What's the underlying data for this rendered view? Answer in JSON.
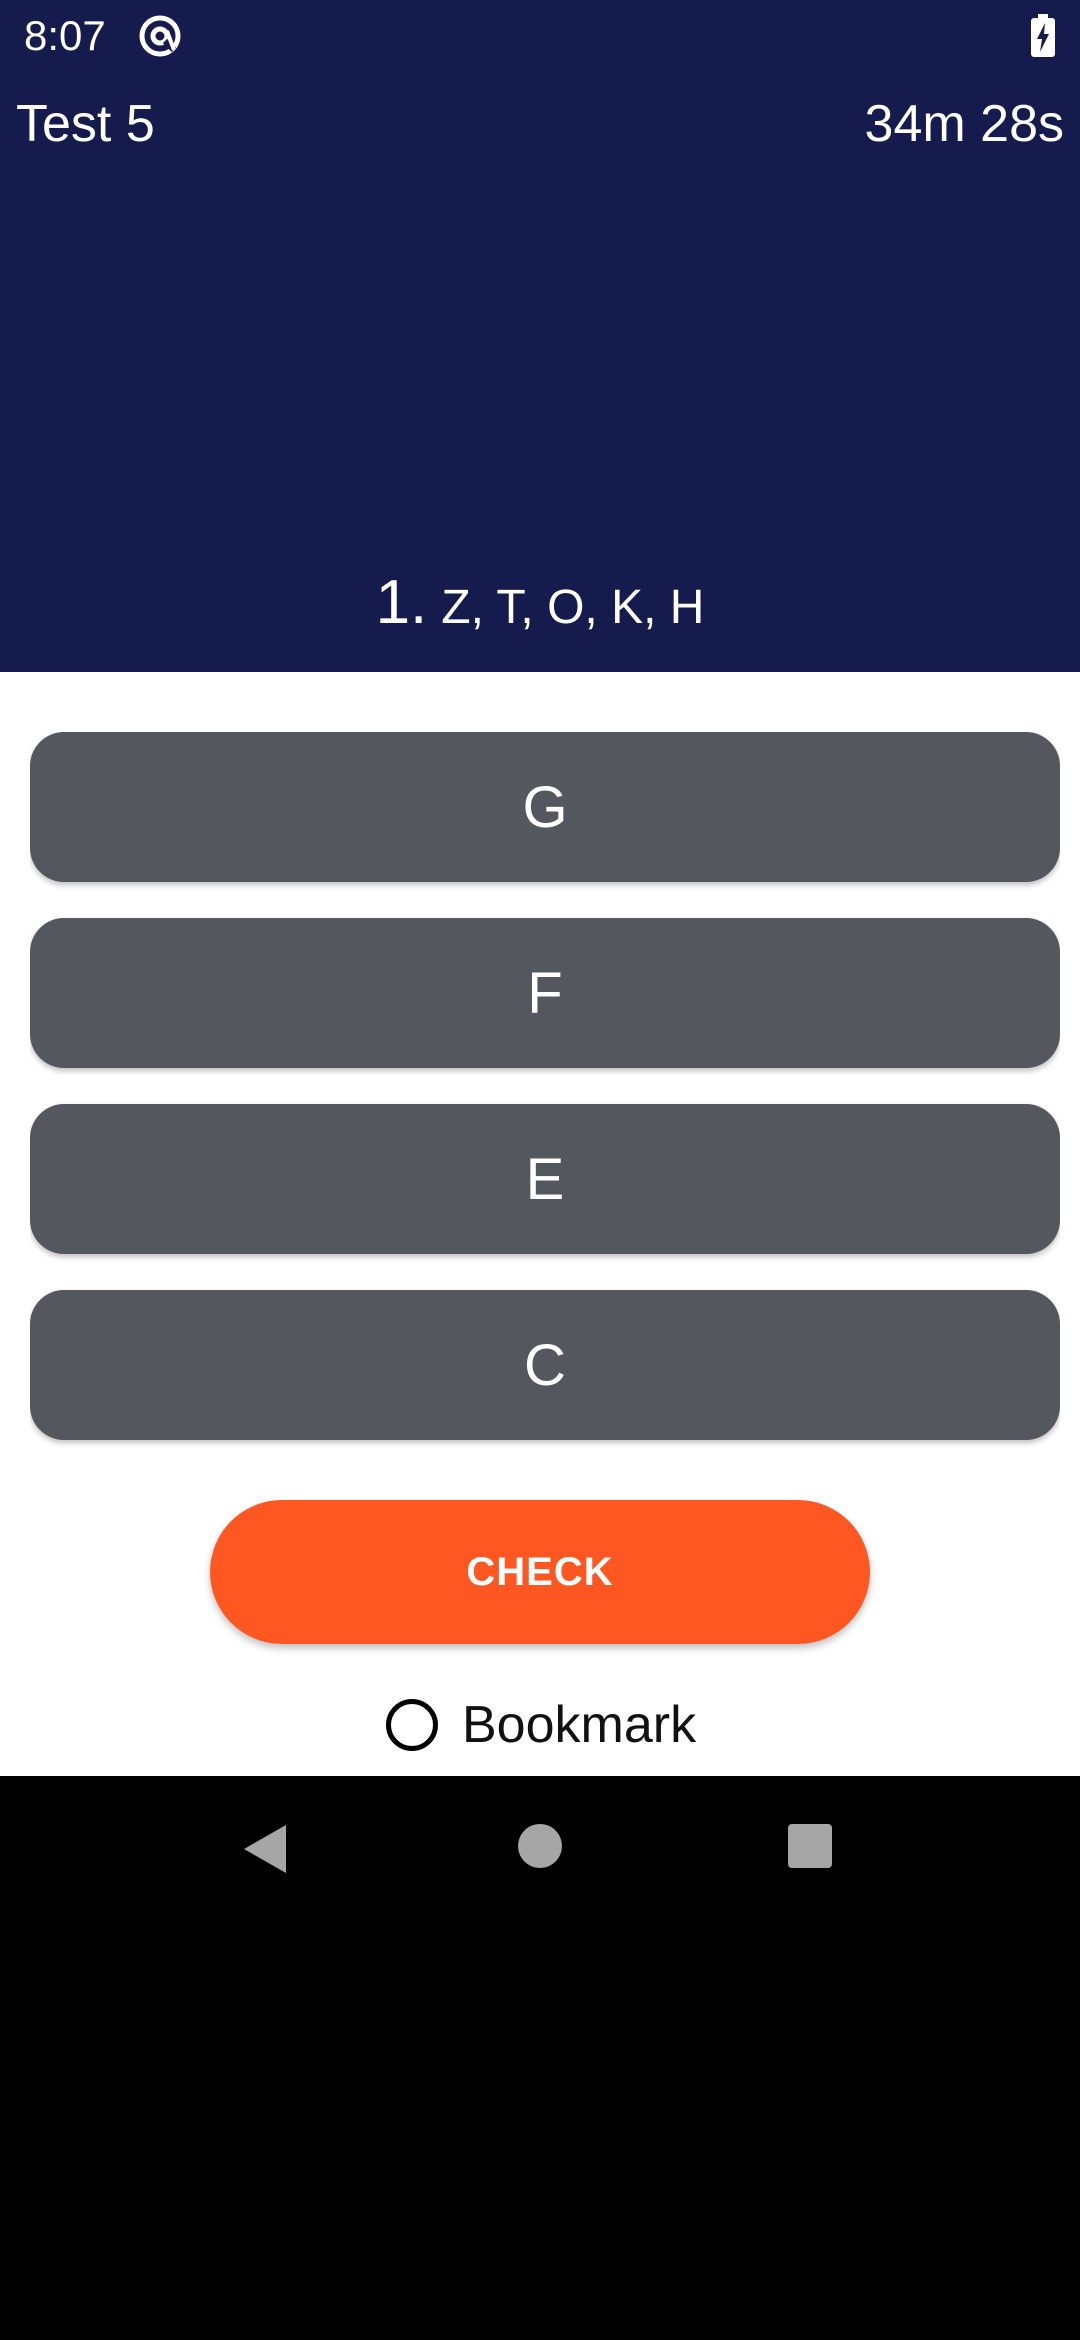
{
  "status_bar": {
    "time": "8:07",
    "app_icon": "at-sign-circle-icon",
    "battery_icon": "battery-charging-icon"
  },
  "header": {
    "title": "Test 5",
    "timer": "34m 28s",
    "background_color": "#161b4e"
  },
  "question": {
    "number": "1.",
    "text": "Z, T, O, K, H"
  },
  "options": [
    {
      "label": "G"
    },
    {
      "label": "F"
    },
    {
      "label": "E"
    },
    {
      "label": "C"
    }
  ],
  "actions": {
    "check_label": "CHECK",
    "check_color": "#ff5722",
    "bookmark_label": "Bookmark",
    "bookmark_checked": false
  },
  "nav_bar": {
    "back_icon": "back-triangle-icon",
    "home_icon": "home-circle-icon",
    "recents_icon": "recents-square-icon"
  }
}
